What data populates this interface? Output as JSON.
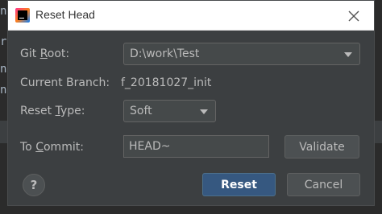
{
  "background": {
    "glyphs": [
      "n",
      "r",
      "n",
      "n"
    ]
  },
  "dialog": {
    "title": "Reset Head",
    "app_icon": "intellij-icon",
    "close_icon": "close-icon"
  },
  "form": {
    "git_root": {
      "label_pre": "Git ",
      "label_mnemonic": "R",
      "label_post": "oot:",
      "value": "D:\\work\\Test"
    },
    "current_branch": {
      "label": "Current Branch:",
      "value": "f_20181027_init"
    },
    "reset_type": {
      "label_pre": "Reset ",
      "label_mnemonic": "T",
      "label_post": "ype:",
      "value": "Soft"
    },
    "to_commit": {
      "label_pre": "To ",
      "label_mnemonic": "C",
      "label_post": "ommit:",
      "value": "HEAD~"
    }
  },
  "buttons": {
    "validate": "Validate",
    "reset": "Reset",
    "cancel": "Cancel",
    "help": "?"
  },
  "colors": {
    "dialog_bg": "#3c3f41",
    "primary_button": "#365880",
    "text": "#bbbbbb"
  }
}
